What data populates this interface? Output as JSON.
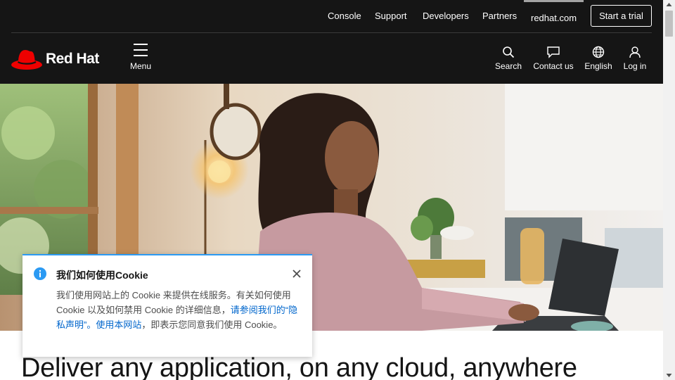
{
  "utility_nav": {
    "links": [
      "Console",
      "Support",
      "Developers",
      "Partners",
      "redhat.com"
    ],
    "cta": "Start a trial"
  },
  "main_nav": {
    "brand": "Red Hat",
    "menu_label": "Menu",
    "actions": {
      "search": "Search",
      "contact": "Contact us",
      "language": "English",
      "login": "Log in"
    }
  },
  "hero": {
    "headline": "Deliver any application, on any cloud, anywhere"
  },
  "cookie_banner": {
    "title": "我们如何使用Cookie",
    "body_before_link": "我们使用网站上的 Cookie 来提供在线服务。有关如何使用 Cookie 以及如何禁用 Cookie 的详细信息，",
    "link_text": "请参阅我们的“隐私声明”。使用本网站",
    "body_after_link": "，即表示您同意我们使用 Cookie。"
  },
  "colors": {
    "nav_background": "#151515",
    "brand_red": "#ee0000",
    "info_blue": "#2b9af3",
    "link_blue": "#0066cc"
  }
}
